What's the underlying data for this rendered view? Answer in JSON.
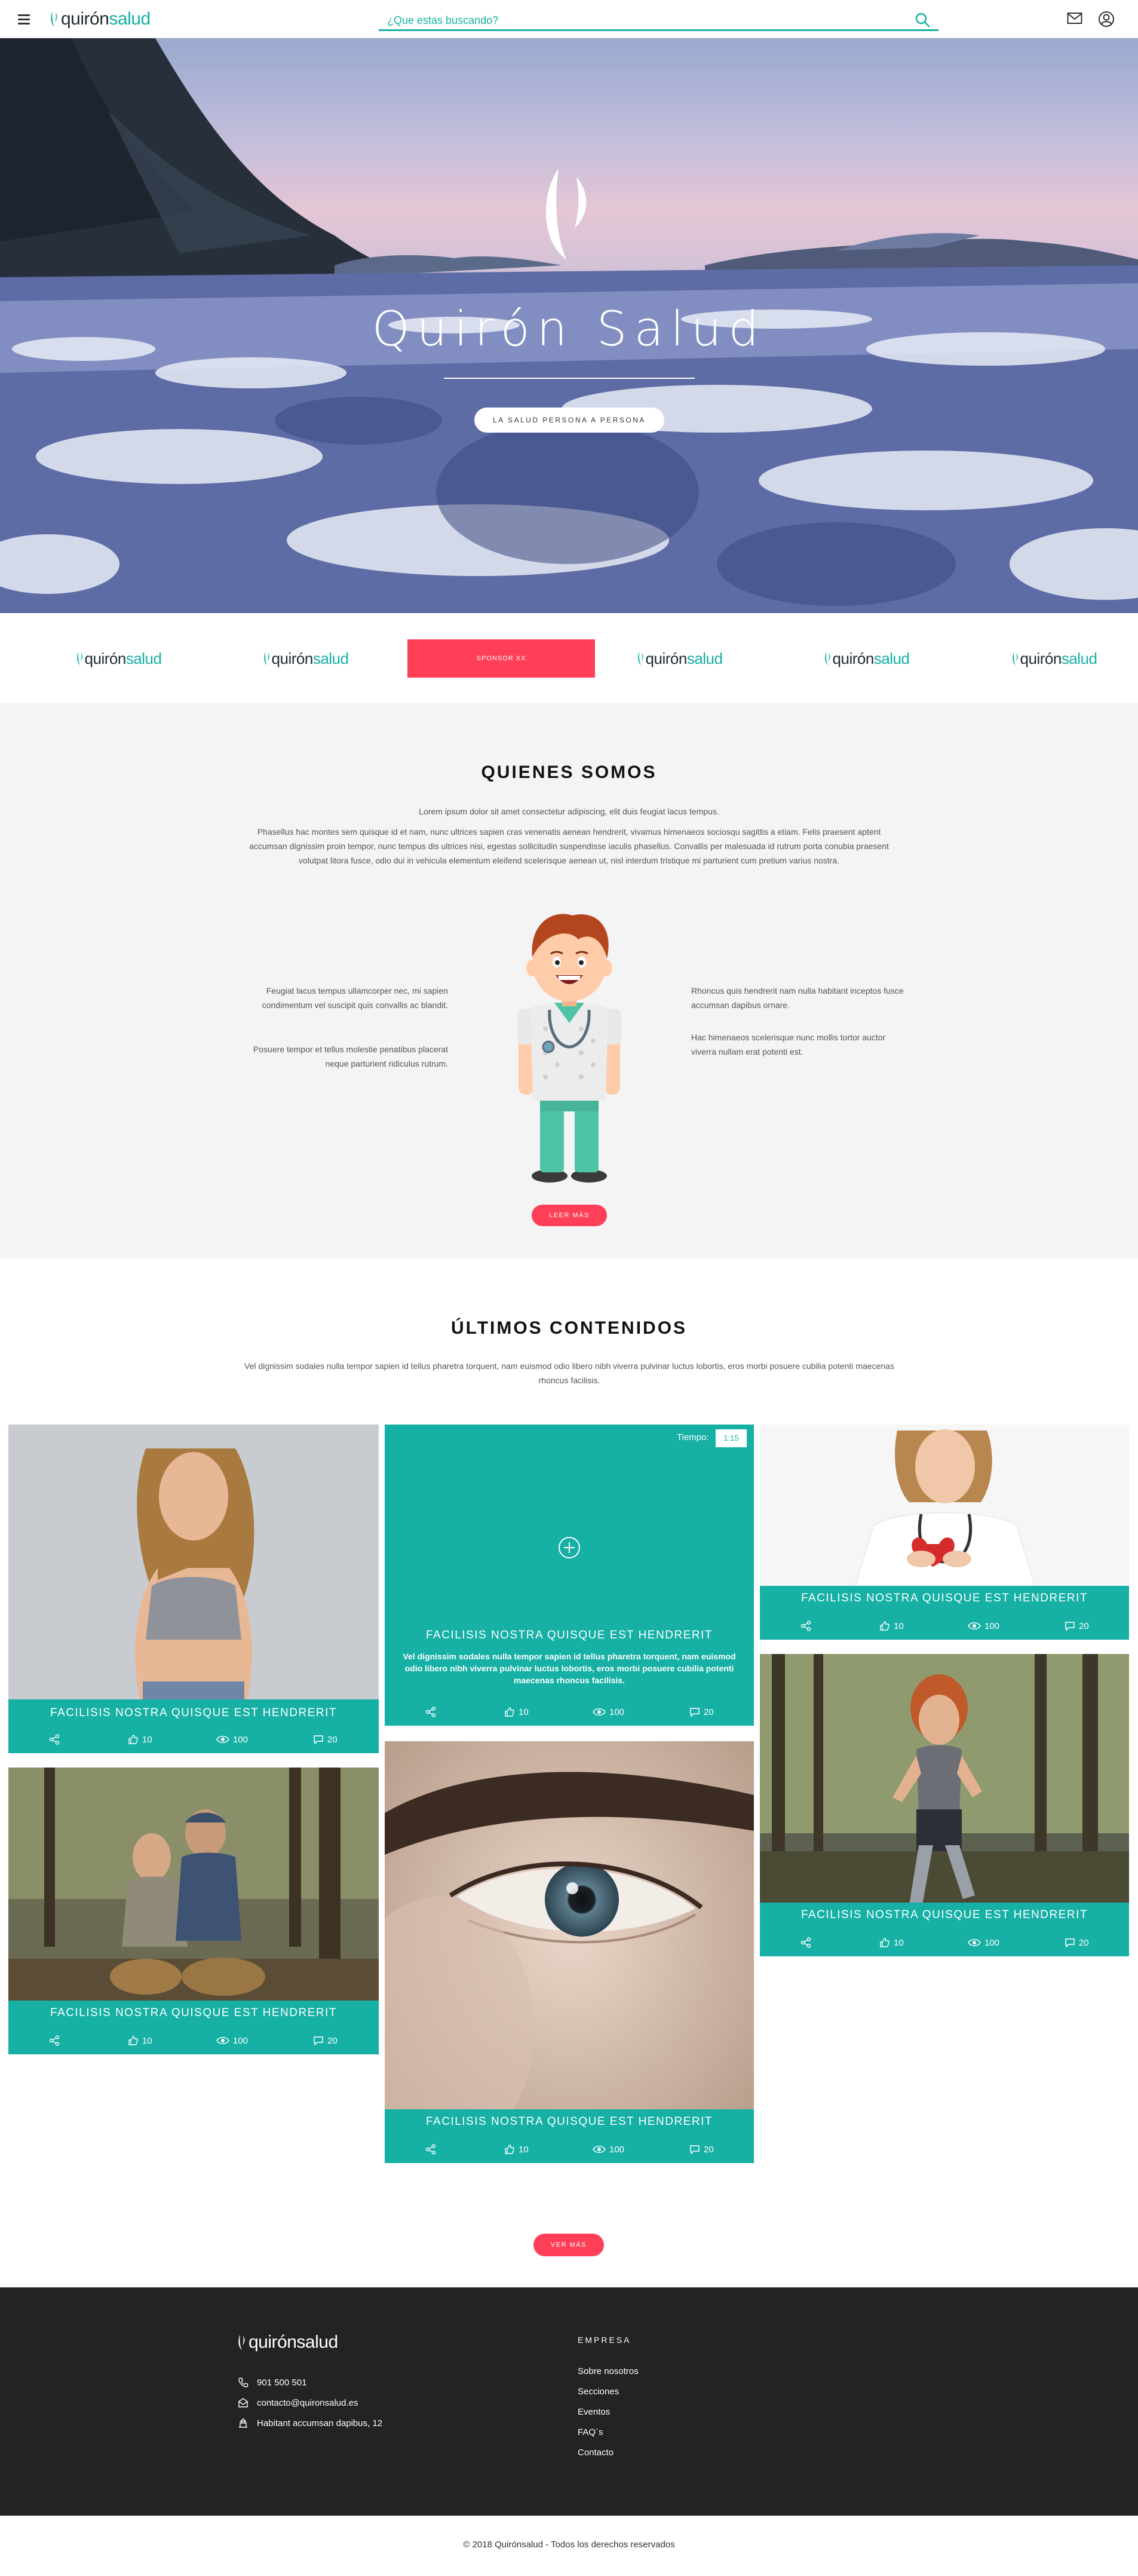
{
  "header": {
    "logo_dark": "quirón",
    "logo_teal": "salud",
    "search_placeholder": "¿Que estas buscando?"
  },
  "hero": {
    "title": "Quirón Salud",
    "button": "LA SALUD PERSONA A PERSONA"
  },
  "sponsors": {
    "logo_dark": "quirón",
    "logo_teal": "salud",
    "sponsor_label": "SPONSOR XX"
  },
  "quienes": {
    "title": "QUIENES SOMOS",
    "intro": "Lorem ipsum dolor sit amet consectetur adipiscing, elit duis feugiat lacus tempus.",
    "paragraph": "Phasellus hac montes sem quisque id et nam, nunc ultrices sapien cras venenatis aenean hendrerit, vivamus himenaeos sociosqu sagittis a etiam. Felis praesent aptent accumsan dignissim proin tempor, nunc tempus dis ultrices nisi, egestas sollicitudin suspendisse iaculis phasellus. Convallis per malesuada id rutrum porta conubia praesent volutpat litora fusce, odio dui in vehicula elementum eleifend scelerisque aenean ut, nisl interdum tristique mi parturient cum pretium varius nostra.",
    "left1": "Feugiat lacus tempus ullamcorper nec, mi sapien condimentum vel suscipit quis convallis ac blandit.",
    "left2": "Posuere tempor et tellus molestie penatibus placerat neque parturient ridiculus rutrum.",
    "right1": "Rhoncus quis hendrerit nam nulla habitant inceptos fusce accumsan dapibus ornare.",
    "right2": "Hac himenaeos scelerisque nunc mollis tortor auctor viverra nullam erat potenti est.",
    "button": "LEER MÁS"
  },
  "contenidos": {
    "title": "ÚLTIMOS CONTENIDOS",
    "intro": "Vel dignissim sodales nulla tempor sapien id tellus pharetra torquent, nam euismod odio libero nibh viverra pulvinar luctus lobortis, eros morbi posuere cubilia potenti maecenas rhoncus facilisis.",
    "card_title": "FACILISIS NOSTRA QUISQUE EST HENDRERIT",
    "featured_text": "Vel dignissim sodales nulla tempor sapien id tellus pharetra torquent, nam euismod odio libero nibh viverra pulvinar luctus lobortis, eros morbi posuere cubilia potenti maecenas rhoncus facilisis.",
    "tiempo_label": "Tiempo:",
    "tiempo_value": "1:15",
    "likes": "10",
    "views": "100",
    "comments": "20",
    "button": "VER MÁS"
  },
  "footer": {
    "logo_dark": "quirón",
    "logo_teal": "salud",
    "phone": "901 500 501",
    "email": "contacto@quironsalud.es",
    "address": "Habitant accumsan dapibus, 12",
    "empresa_title": "EMPRESA",
    "links": [
      "Sobre nosotros",
      "Secciones",
      "Eventos",
      "FAQ´s",
      "Contacto"
    ],
    "copyright": "© 2018 Quirónsalud - Todos los derechos reservados"
  },
  "colors": {
    "teal": "#16b0a5",
    "pink": "#ff3f57",
    "footer_bg": "#232323",
    "section_bg": "#f4f4f4"
  },
  "icons": [
    "menu-icon",
    "search-icon",
    "mail-icon",
    "user-icon",
    "share-icon",
    "like-icon",
    "eye-icon",
    "comment-icon",
    "plus-icon",
    "phone-icon",
    "email-icon",
    "location-icon"
  ]
}
